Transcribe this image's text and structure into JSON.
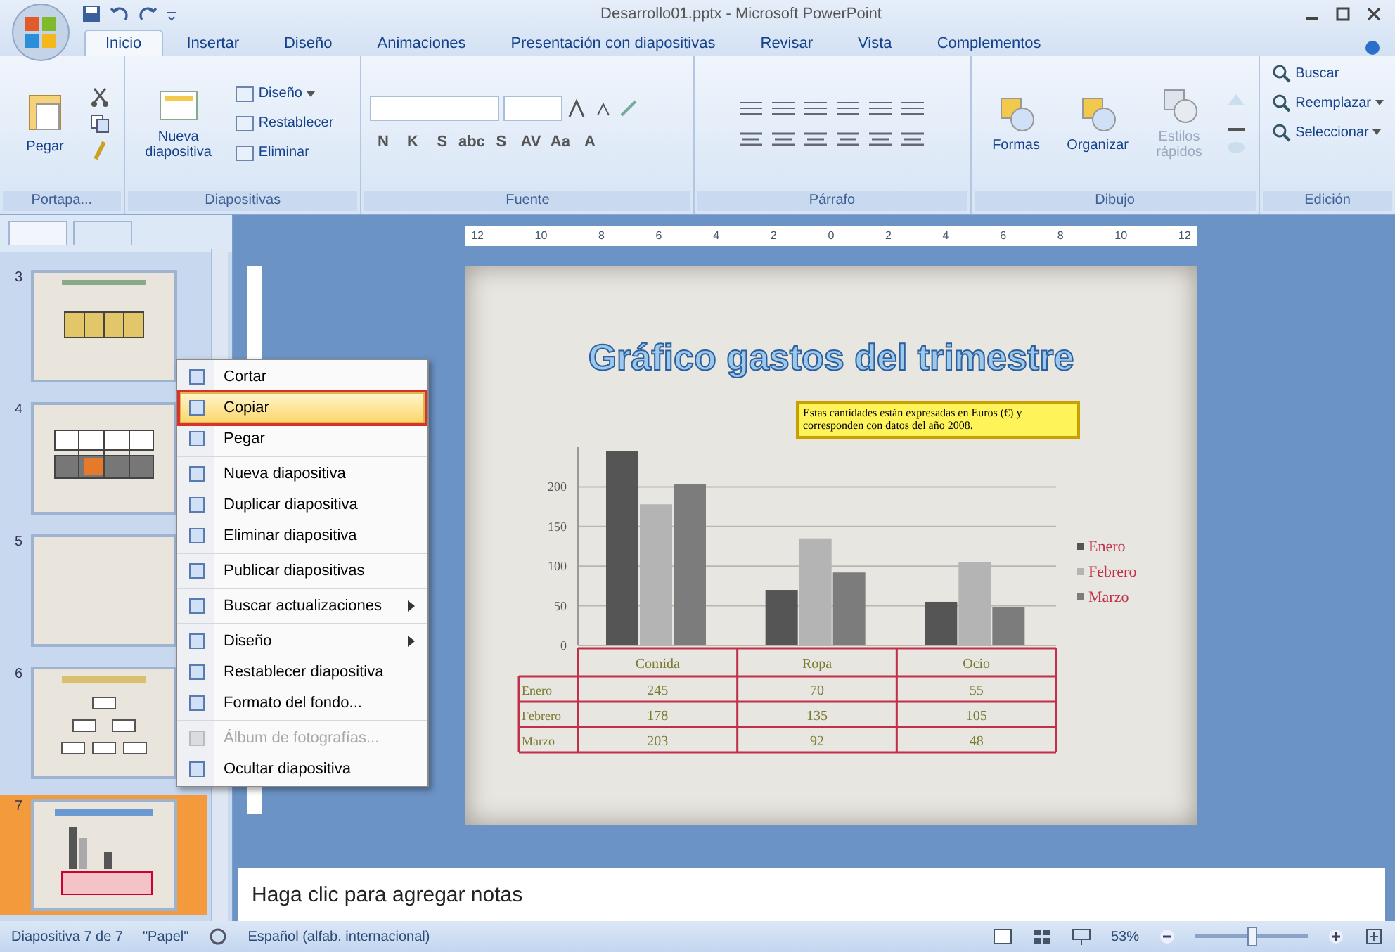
{
  "window": {
    "title": "Desarrollo01.pptx - Microsoft PowerPoint"
  },
  "ribbon": {
    "tabs": [
      {
        "label": "Inicio",
        "selected": true
      },
      {
        "label": "Insertar",
        "selected": false
      },
      {
        "label": "Diseño",
        "selected": false
      },
      {
        "label": "Animaciones",
        "selected": false
      },
      {
        "label": "Presentación con diapositivas",
        "selected": false
      },
      {
        "label": "Revisar",
        "selected": false
      },
      {
        "label": "Vista",
        "selected": false
      },
      {
        "label": "Complementos",
        "selected": false
      }
    ],
    "clipboard": {
      "label": "Portapa...",
      "paste": "Pegar"
    },
    "slides": {
      "label": "Diapositivas",
      "new_slide": "Nueva diapositiva",
      "small": [
        {
          "label": "Diseño",
          "dropdown": true
        },
        {
          "label": "Restablecer",
          "dropdown": false
        },
        {
          "label": "Eliminar",
          "dropdown": false
        }
      ]
    },
    "font": {
      "label": "Fuente",
      "buttons": [
        "N",
        "K",
        "S",
        "abc",
        "S",
        "AV",
        "Aa",
        "A"
      ]
    },
    "paragraph": {
      "label": "Párrafo"
    },
    "drawing": {
      "label": "Dibujo",
      "buttons": [
        {
          "label": "Formas",
          "disabled": false
        },
        {
          "label": "Organizar",
          "disabled": false
        },
        {
          "label": "Estilos rápidos",
          "disabled": true
        }
      ]
    },
    "editing": {
      "label": "Edición",
      "buttons": [
        {
          "label": "Buscar",
          "dropdown": false
        },
        {
          "label": "Reemplazar",
          "dropdown": true
        },
        {
          "label": "Seleccionar",
          "dropdown": true
        }
      ]
    }
  },
  "slide_panel": {
    "slides": [
      {
        "number": "3",
        "kind": "table",
        "selected": false
      },
      {
        "number": "4",
        "kind": "grid",
        "selected": false
      },
      {
        "number": "5",
        "kind": "blank",
        "selected": false
      },
      {
        "number": "6",
        "kind": "diagram",
        "selected": false
      },
      {
        "number": "7",
        "kind": "chart",
        "selected": true
      }
    ]
  },
  "context_menu": {
    "sections": [
      {
        "items": [
          {
            "label": "Cortar",
            "selected": false,
            "disabled": false,
            "submenu": false
          },
          {
            "label": "Copiar",
            "selected": true,
            "disabled": false,
            "submenu": false
          },
          {
            "label": "Pegar",
            "selected": false,
            "disabled": false,
            "submenu": false
          }
        ]
      },
      {
        "items": [
          {
            "label": "Nueva diapositiva",
            "selected": false,
            "disabled": false,
            "submenu": false
          },
          {
            "label": "Duplicar diapositiva",
            "selected": false,
            "disabled": false,
            "submenu": false
          },
          {
            "label": "Eliminar diapositiva",
            "selected": false,
            "disabled": false,
            "submenu": false
          }
        ]
      },
      {
        "items": [
          {
            "label": "Publicar diapositivas",
            "selected": false,
            "disabled": false,
            "submenu": false
          }
        ]
      },
      {
        "items": [
          {
            "label": "Buscar actualizaciones",
            "selected": false,
            "disabled": false,
            "submenu": true
          }
        ]
      },
      {
        "items": [
          {
            "label": "Diseño",
            "selected": false,
            "disabled": false,
            "submenu": true
          },
          {
            "label": "Restablecer diapositiva",
            "selected": false,
            "disabled": false,
            "submenu": false
          },
          {
            "label": "Formato del fondo...",
            "selected": false,
            "disabled": false,
            "submenu": false
          }
        ]
      },
      {
        "items": [
          {
            "label": "Álbum de fotografías...",
            "selected": false,
            "disabled": true,
            "submenu": false
          },
          {
            "label": "Ocultar diapositiva",
            "selected": false,
            "disabled": false,
            "submenu": false
          }
        ]
      }
    ]
  },
  "ruler": {
    "marks": [
      "12",
      "10",
      "8",
      "6",
      "4",
      "2",
      "0",
      "2",
      "4",
      "6",
      "8",
      "10",
      "12"
    ]
  },
  "slide": {
    "title": "Gráfico gastos del trimestre",
    "note": "Estas cantidades están expresadas en Euros (€) y corresponden con datos del año 2008.",
    "chart_data": {
      "type": "bar",
      "categories": [
        "Comida",
        "Ropa",
        "Ocio"
      ],
      "series": [
        {
          "name": "Enero",
          "color": "#555555",
          "values": [
            245,
            70,
            55
          ]
        },
        {
          "name": "Febrero",
          "color": "#b4b4b4",
          "values": [
            178,
            135,
            105
          ]
        },
        {
          "name": "Marzo",
          "color": "#7c7c7c",
          "values": [
            203,
            92,
            48
          ]
        }
      ],
      "ylim": [
        0,
        250
      ],
      "yticks": [
        0,
        50,
        100,
        150,
        200
      ],
      "grid": true,
      "legend": true
    },
    "data_table": {
      "rows": [
        {
          "label": "Enero",
          "cells": [
            "245",
            "70",
            "55"
          ]
        },
        {
          "label": "Febrero",
          "cells": [
            "178",
            "135",
            "105"
          ]
        },
        {
          "label": "Marzo",
          "cells": [
            "203",
            "92",
            "48"
          ]
        }
      ]
    }
  },
  "notes": {
    "placeholder": "Haga clic para agregar notas"
  },
  "status_bar": {
    "slide_info": "Diapositiva 7 de 7",
    "theme": "\"Papel\"",
    "language": "Español (alfab. internacional)",
    "zoom": "53%",
    "zoom_slider": {
      "level": 0.5
    }
  }
}
